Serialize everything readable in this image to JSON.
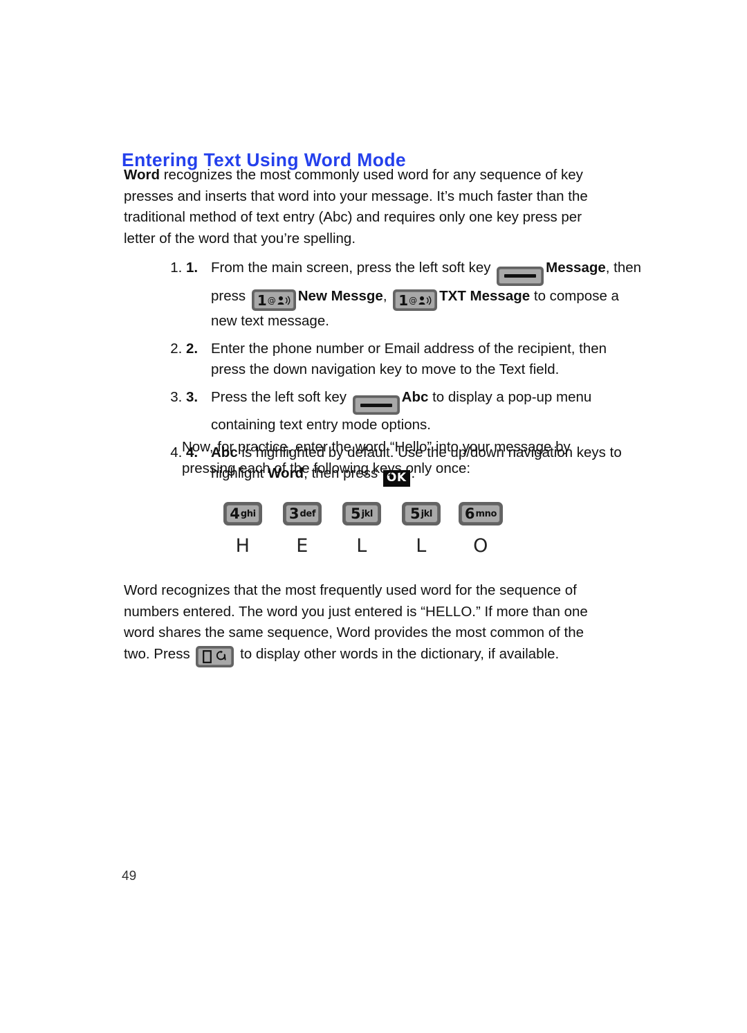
{
  "page": {
    "number": "49",
    "heading": "Entering Text Using Word Mode",
    "accent_color": "#2440ec",
    "key_icon_outer_color": "#636363",
    "key_icon_inner_color": "#a8a8a8"
  },
  "intro": {
    "lead_bold": "Word",
    "text": " recognizes the most commonly used word for any sequence of key presses and inserts that word into your message. It’s much faster than the traditional method of text entry (Abc) and requires only one key press per letter of the word that you’re spelling."
  },
  "steps": [
    {
      "num": "1.",
      "parts": [
        {
          "type": "text",
          "value": "From the main screen, press the left soft key "
        },
        {
          "type": "icon",
          "icon": "soft-key-icon"
        },
        {
          "type": "bold",
          "value": "Message"
        },
        {
          "type": "text",
          "value": ", then press "
        },
        {
          "type": "icon",
          "icon": "key-1-message-icon"
        },
        {
          "type": "bold",
          "value": "New Messge"
        },
        {
          "type": "text",
          "value": ", "
        },
        {
          "type": "icon",
          "icon": "key-1-message-icon"
        },
        {
          "type": "bold",
          "value": "TXT Message"
        },
        {
          "type": "text",
          "value": " to compose a new text message."
        }
      ]
    },
    {
      "num": "2.",
      "parts": [
        {
          "type": "text",
          "value": "Enter the phone number or Email address of the recipient, then press the down navigation key to move to the Text field."
        }
      ]
    },
    {
      "num": "3.",
      "parts": [
        {
          "type": "text",
          "value": "Press the left soft key "
        },
        {
          "type": "icon",
          "icon": "soft-key-icon"
        },
        {
          "type": "bold",
          "value": "Abc"
        },
        {
          "type": "text",
          "value": " to display a pop-up menu containing text entry mode options."
        }
      ]
    },
    {
      "num": "4.",
      "parts": [
        {
          "type": "bold",
          "value": "Abc"
        },
        {
          "type": "text",
          "value": " is highlighted by default. Use the up/down navigation keys to highlight "
        },
        {
          "type": "bold",
          "value": "Word"
        },
        {
          "type": "text",
          "value": ", then press "
        },
        {
          "type": "icon",
          "icon": "ok-key-icon"
        },
        {
          "type": "text",
          "value": "."
        }
      ]
    }
  ],
  "practice": {
    "text": "Now, for practice, enter the word “Hello” into your message by pressing each of the following keys only once:"
  },
  "keypad_demo": [
    {
      "digit": "4",
      "sub": "ghi",
      "letter": "H"
    },
    {
      "digit": "3",
      "sub": "def",
      "letter": "E"
    },
    {
      "digit": "5",
      "sub": "jkl",
      "letter": "L"
    },
    {
      "digit": "5",
      "sub": "jkl",
      "letter": "L"
    },
    {
      "digit": "6",
      "sub": "mno",
      "letter": "O"
    }
  ],
  "outro": {
    "part1": "Word recognizes that the most frequently used word for the sequence of numbers entered. The word you just entered is “HELLO.” If more than one word shares the same sequence, Word provides the most common of the two. Press ",
    "icon": "key-0-next-word-icon",
    "part2": " to display other words in the dictionary, if available."
  },
  "icons": {
    "soft-key-icon": "left-soft-key",
    "key-1-message-icon": "1 @ message key",
    "key-0-next-word-icon": "0 next-word key",
    "ok-key-icon": "OK"
  },
  "ok_key_label": "OK"
}
